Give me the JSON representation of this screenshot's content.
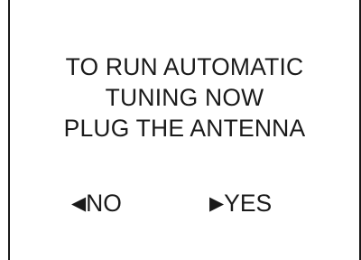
{
  "prompt": {
    "lines": [
      "TO RUN AUTOMATIC",
      "TUNING NOW",
      "PLUG THE ANTENNA"
    ]
  },
  "choices": {
    "no": {
      "label": "NO",
      "icon": "arrow-left-icon"
    },
    "yes": {
      "label": "YES",
      "icon": "arrow-right-icon"
    }
  },
  "colors": {
    "text": "#1a1a1a",
    "background": "#ffffff"
  }
}
